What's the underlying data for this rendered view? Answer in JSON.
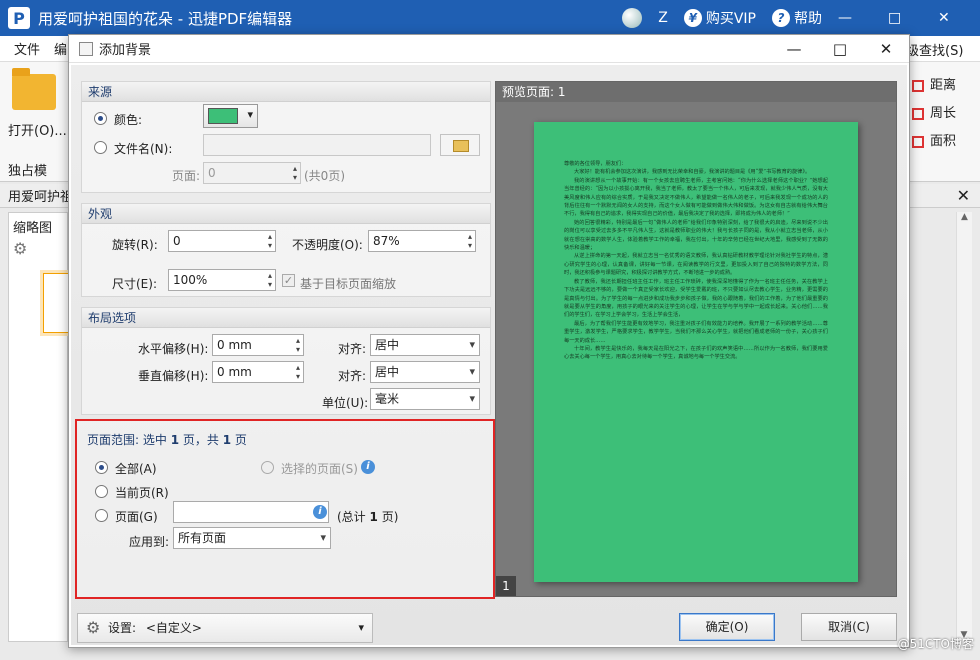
{
  "app": {
    "logo": "P",
    "title": "用爱呵护祖国的花朵 - 迅捷PDF编辑器",
    "user_letter": "Z",
    "buy_vip": "购买VIP",
    "help": "帮助",
    "vip_icon": "¥",
    "help_icon": "?"
  },
  "menubar": {
    "file": "文件",
    "edit": "编"
  },
  "ribbon": {
    "open_label": "打开(O)...",
    "exclusive_label": "独占模",
    "find_label": "级查找(S)",
    "right_tools": [
      "距离",
      "周长",
      "面积"
    ]
  },
  "doc_tab": {
    "label": "用爱呵护祖"
  },
  "thumb_panel": {
    "title": "缩略图"
  },
  "dialog": {
    "title": "添加背景",
    "source": {
      "header": "来源",
      "color_label": "颜色:",
      "color_value": "#3dbf78",
      "file_label": "文件名(N):",
      "file_value": "",
      "page_label": "页面:",
      "page_value": "0",
      "page_total": "(共0页)"
    },
    "appearance": {
      "header": "外观",
      "rotate_label": "旋转(R):",
      "rotate_value": "0",
      "opacity_label": "不透明度(O):",
      "opacity_value": "87%",
      "size_label": "尺寸(E):",
      "size_value": "100%",
      "scale_label": "基于目标页面缩放"
    },
    "layout": {
      "header": "布局选项",
      "h_offset_label": "水平偏移(H):",
      "h_offset_value": "0 mm",
      "v_offset_label": "垂直偏移(H):",
      "v_offset_value": "0 mm",
      "align_label": "对齐:",
      "h_align_value": "居中",
      "v_align_value": "居中",
      "unit_label": "单位(U):",
      "unit_value": "毫米"
    },
    "page_range": {
      "header_prefix": "页面范围: 选中",
      "selected_count": "1",
      "header_mid": "页，共",
      "total_count": "1",
      "header_suffix": "页",
      "all_label": "全部(A)",
      "selected_pages_label": "选择的页面(S)",
      "current_label": "当前页(R)",
      "pages_label": "页面(G)",
      "pages_value": "",
      "total_prefix": "(总计",
      "total_value": "1",
      "total_suffix": "页)",
      "apply_label": "应用到:",
      "apply_value": "所有页面"
    },
    "preview": {
      "header": "预览页面: 1",
      "page_number": "1",
      "doc_paragraphs": [
        "尊敬的各位领导，朋友们：",
        "大家好！能有机会参加这次演讲，我感到无比荣幸和自豪，我演讲的题目是《用“爱”书写教育的旋律》。",
        "我的演讲想从一个故事开始：有一个女孩去应聘生老师，主考官问她：“你为什么选择老师这个职业？”她想起当年曾经的：“因为以小孩拔心离开我，我当了老师，教太了要当一个伟人，可后来发现，就我少伟人气质，没有大美风度和伟人应有的综合实质，于是我又决定不做伟人，希望能做一名伟人的老子，可后来我发现一个成功的人的背后往往有一个默默无闻的女人的支持，而这个女人做有可能做到做伟大伟和做饭。为这女有自古就有给伟大舞台不行，我得有自己的追求，我得实现自己的价值，最后我决定了我的选择，即将成为伟人的老师！”",
        "她的回答很精彩，特别是最后一句“做伟人的老师”给我们印象特别深刻，给了我很大的启迪，尽来到说不少出的岗位可以享受过去多多不平凡伟人生，这就是教师职业的伟大！我与长孩子同的是，我从小就立志当老师，从小就在想在崇高的数学人生，体验着教学工作的幸福，我在付出，十年的辛劳已经在世纪大地里，我感受到了无数的快乐和温暖；",
        "从逆上拼命的第一天起，我就立志当一名优秀的语文教师，我认真钻研教材教学理论针对我社学生的特点，潜心研究学生的心理，认真备课，讲好每一节课，在阅读教学的行文里，更加投入到了自己的独特的数学方法，同时，我还积极参与课题研究，积极探讨讲教学方式，不断地进一步的成熟。",
        "教了教师，我还长期担任班主任工作，班主任工作琐碎，使我深深地懂得了作为一名班主任任务，关在教学上下功夫是远远不够的，要做一个真正受家长欢迎，受学生爱戴的班，不只要如认尽去教心学生，业务精，更需要的是真情与付出。为了学生的每一点进步和成功我步步和孩子做，我的心跟随着，我们的工作着，为了他们最重要的就是要从学生的角度，用孩子的眼光来的关注学生的心理，让学生在学与学与学中一起成长起来。关心他们……我们的学生们，在学习上学会学习，生活上学会生活，",
        "最后，为了帮我们学生能更有效地学习，我注重对孩子们有效能力的培养。我开展了一系列的教学活动……尊重学生，激发学生，严格要求学生，教学学生，当我们不那么关心学生，就把他们看成老师的一份子，关心孩子们每一天的成长……",
        "十年间，教学生是快乐的，我每天是在阳光之下，在孩子们的欢声笑语中……所以作为一名教师，我们要用爱心去关心每一个学生，用真心去对待每一个学生，真诚地与每一个学生交流。"
      ]
    },
    "settings_label": "设置:",
    "settings_value": "<自定义>",
    "ok_label": "确定(O)",
    "cancel_label": "取消(C)"
  },
  "watermark": "@51CTO博客"
}
